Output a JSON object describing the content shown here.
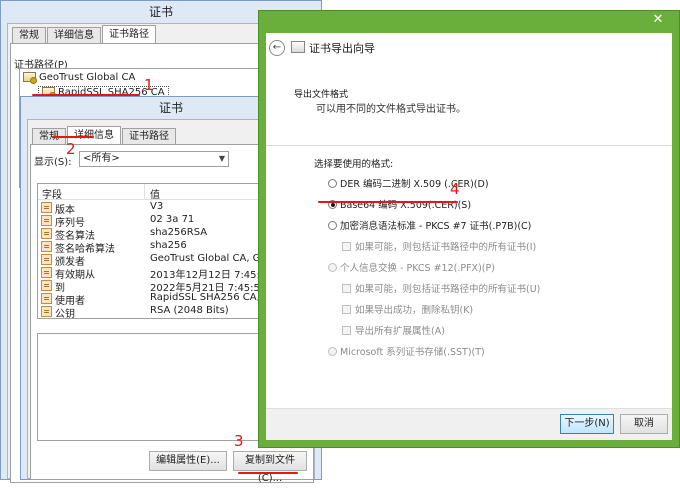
{
  "back_window": {
    "title": "证书",
    "tabs": [
      "常规",
      "详细信息",
      "证书路径"
    ],
    "path_label": "证书路径(P)",
    "path_items": [
      "GeoTrust Global CA",
      "RapidSSL SHA256 CA"
    ]
  },
  "front_window": {
    "title": "证书",
    "tabs": [
      "常规",
      "详细信息",
      "证书路径"
    ],
    "show_label": "显示(S):",
    "show_value": "<所有>",
    "columns": [
      "字段",
      "值"
    ],
    "rows": [
      {
        "field": "版本",
        "value": "V3"
      },
      {
        "field": "序列号",
        "value": "02 3a 71"
      },
      {
        "field": "签名算法",
        "value": "sha256RSA"
      },
      {
        "field": "签名哈希算法",
        "value": "sha256"
      },
      {
        "field": "颁发者",
        "value": "GeoTrust Global CA, Geo..."
      },
      {
        "field": "有效期从",
        "value": "2013年12月12日 7:45:51"
      },
      {
        "field": "到",
        "value": "2022年5月21日 7:45:51"
      },
      {
        "field": "使用者",
        "value": "RapidSSL SHA256 CA, Geo..."
      },
      {
        "field": "公钥",
        "value": "RSA (2048 Bits)"
      }
    ],
    "edit_button": "编辑属性(E)...",
    "copy_button": "复制到文件(C)..."
  },
  "wizard": {
    "title": "证书导出向导",
    "close": "✕",
    "section_title": "导出文件格式",
    "section_desc": "可以用不同的文件格式导出证书。",
    "select_label": "选择要使用的格式:",
    "options": [
      {
        "label": "DER 编码二进制 X.509 (.CER)(D)",
        "selected": false,
        "enabled": true
      },
      {
        "label": "Base64 编码 X.509(.CER)(S)",
        "selected": true,
        "enabled": true
      },
      {
        "label": "加密消息语法标准 - PKCS #7 证书(.P7B)(C)",
        "selected": false,
        "enabled": true
      },
      {
        "label": "个人信息交换 - PKCS #12(.PFX)(P)",
        "selected": false,
        "enabled": false
      },
      {
        "label": "Microsoft 系列证书存储(.SST)(T)",
        "selected": false,
        "enabled": false
      }
    ],
    "suboptions": [
      "如果可能，则包括证书路径中的所有证书(I)",
      "如果可能，则包括证书路径中的所有证书(U)",
      "如果导出成功，删除私钥(K)",
      "导出所有扩展属性(A)"
    ],
    "next_button": "下一步(N)",
    "cancel_button": "取消"
  },
  "annotations": [
    "1",
    "2",
    "3",
    "4"
  ],
  "colors": {
    "wizard_frame": "#6aae3c",
    "annotation": "#e01818",
    "window_frame": "#dfe9f5"
  }
}
